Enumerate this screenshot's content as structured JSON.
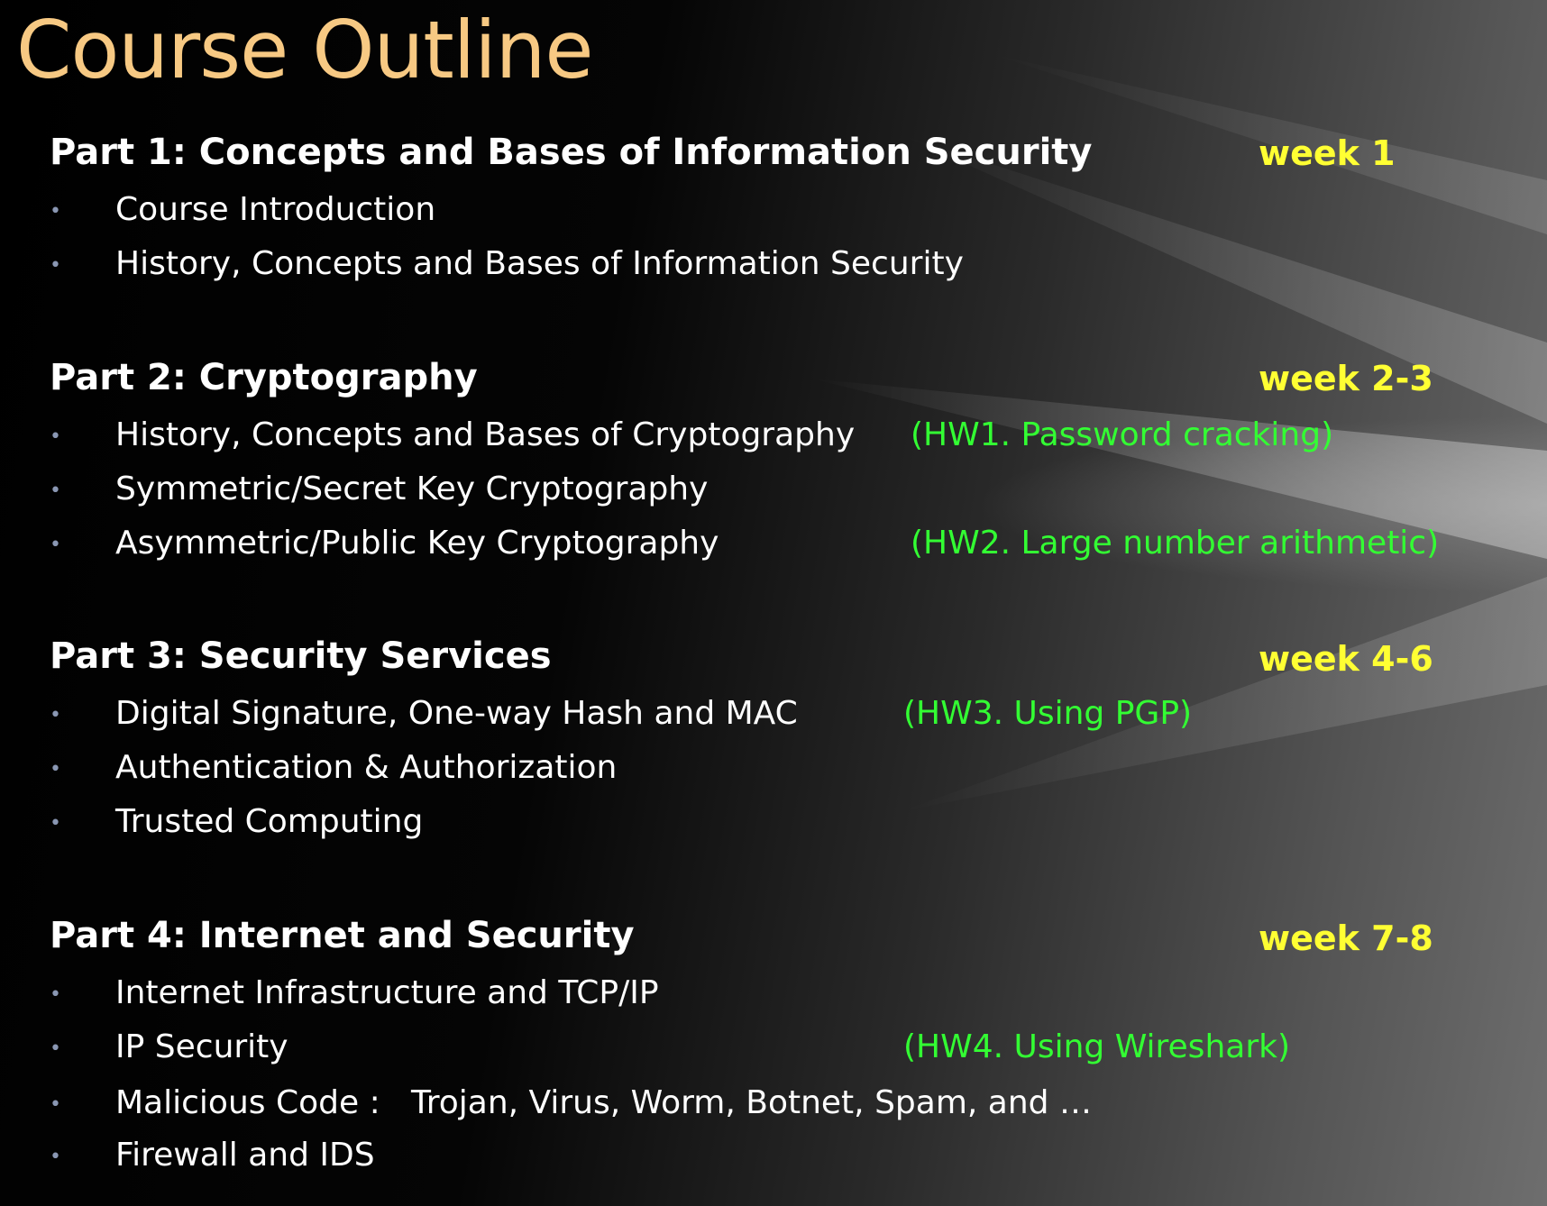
{
  "slide": {
    "title": "Course Outline",
    "colors": {
      "title": "#f7c983",
      "week": "#ffff33",
      "homework": "#33ff33",
      "text": "#ffffff",
      "bullet": "#8a97b3"
    },
    "bullet_glyph": "•",
    "parts": [
      {
        "heading": "Part 1: Concepts and Bases of Information Security",
        "week": "week 1",
        "items": [
          {
            "text": "Course Introduction",
            "hw": ""
          },
          {
            "text": "History, Concepts and Bases of Information Security",
            "hw": ""
          }
        ]
      },
      {
        "heading": "Part 2: Cryptography",
        "week": "week 2-3",
        "items": [
          {
            "text": "History, Concepts and Bases of Cryptography",
            "hw": "(HW1. Password cracking)"
          },
          {
            "text": "Symmetric/Secret Key Cryptography",
            "hw": ""
          },
          {
            "text": "Asymmetric/Public Key Cryptography",
            "hw": "(HW2. Large number arithmetic)"
          }
        ]
      },
      {
        "heading": "Part 3: Security Services",
        "week": "week 4-6",
        "items": [
          {
            "text": "Digital Signature, One-way Hash and MAC",
            "hw": "(HW3. Using PGP)"
          },
          {
            "text": "Authentication & Authorization",
            "hw": ""
          },
          {
            "text": "Trusted Computing",
            "hw": ""
          }
        ]
      },
      {
        "heading": "Part 4: Internet and Security",
        "week": "week 7-8",
        "items": [
          {
            "text": "Internet Infrastructure and TCP/IP",
            "hw": ""
          },
          {
            "text": "IP Security",
            "hw": "(HW4. Using Wireshark)"
          },
          {
            "text": "Malicious Code :   Trojan, Virus, Worm, Botnet, Spam, and …",
            "hw": ""
          },
          {
            "text": "Firewall and IDS",
            "hw": ""
          }
        ]
      }
    ]
  }
}
